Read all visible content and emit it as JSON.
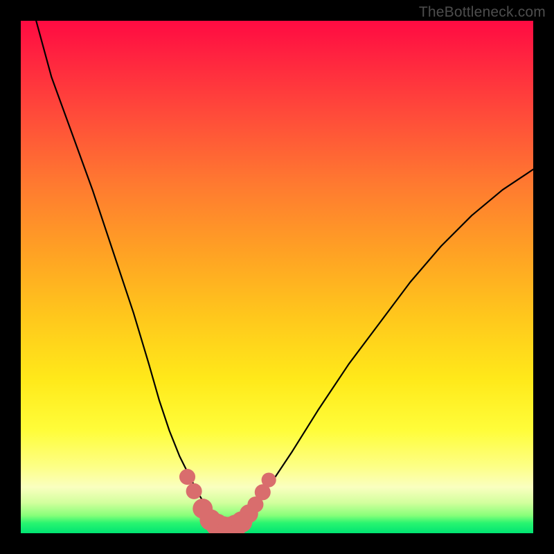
{
  "watermark": "TheBottleneck.com",
  "colors": {
    "frame": "#000000",
    "curve": "#000000",
    "marker_fill": "#d96d6d",
    "marker_stroke": "#c45555"
  },
  "chart_data": {
    "type": "line",
    "title": "",
    "xlabel": "",
    "ylabel": "",
    "xlim": [
      0,
      100
    ],
    "ylim": [
      0,
      100
    ],
    "series": [
      {
        "name": "left_curve",
        "x": [
          3,
          6,
          10,
          14,
          18,
          22,
          25,
          27,
          29,
          31,
          33,
          34.5,
          36,
          37.5,
          38.5,
          39.2
        ],
        "y": [
          100,
          89,
          78,
          67,
          55,
          43,
          33,
          26,
          20,
          15,
          11,
          8,
          5.5,
          3.5,
          2,
          1
        ]
      },
      {
        "name": "valley_floor",
        "x": [
          36,
          37,
          38,
          39,
          40,
          41,
          42,
          43,
          44
        ],
        "y": [
          3.2,
          1.8,
          1.1,
          0.6,
          0.5,
          0.6,
          1.0,
          1.9,
          3.3
        ]
      },
      {
        "name": "right_curve",
        "x": [
          42,
          44,
          46,
          49,
          53,
          58,
          64,
          70,
          76,
          82,
          88,
          94,
          100
        ],
        "y": [
          1,
          3,
          6,
          10,
          16,
          24,
          33,
          41,
          49,
          56,
          62,
          67,
          71
        ]
      }
    ],
    "markers": {
      "name": "salmon_dots",
      "points": [
        {
          "x": 32.5,
          "y": 11.0,
          "r": 1.2
        },
        {
          "x": 33.8,
          "y": 8.2,
          "r": 1.2
        },
        {
          "x": 35.5,
          "y": 4.8,
          "r": 1.5
        },
        {
          "x": 37.0,
          "y": 2.6,
          "r": 1.6
        },
        {
          "x": 38.3,
          "y": 1.6,
          "r": 1.7
        },
        {
          "x": 39.5,
          "y": 1.1,
          "r": 1.7
        },
        {
          "x": 40.7,
          "y": 1.0,
          "r": 1.7
        },
        {
          "x": 41.9,
          "y": 1.4,
          "r": 1.7
        },
        {
          "x": 43.1,
          "y": 2.2,
          "r": 1.6
        },
        {
          "x": 44.5,
          "y": 3.8,
          "r": 1.4
        },
        {
          "x": 45.8,
          "y": 5.6,
          "r": 1.2
        },
        {
          "x": 47.2,
          "y": 8.0,
          "r": 1.2
        },
        {
          "x": 48.4,
          "y": 10.4,
          "r": 1.1
        }
      ]
    }
  }
}
